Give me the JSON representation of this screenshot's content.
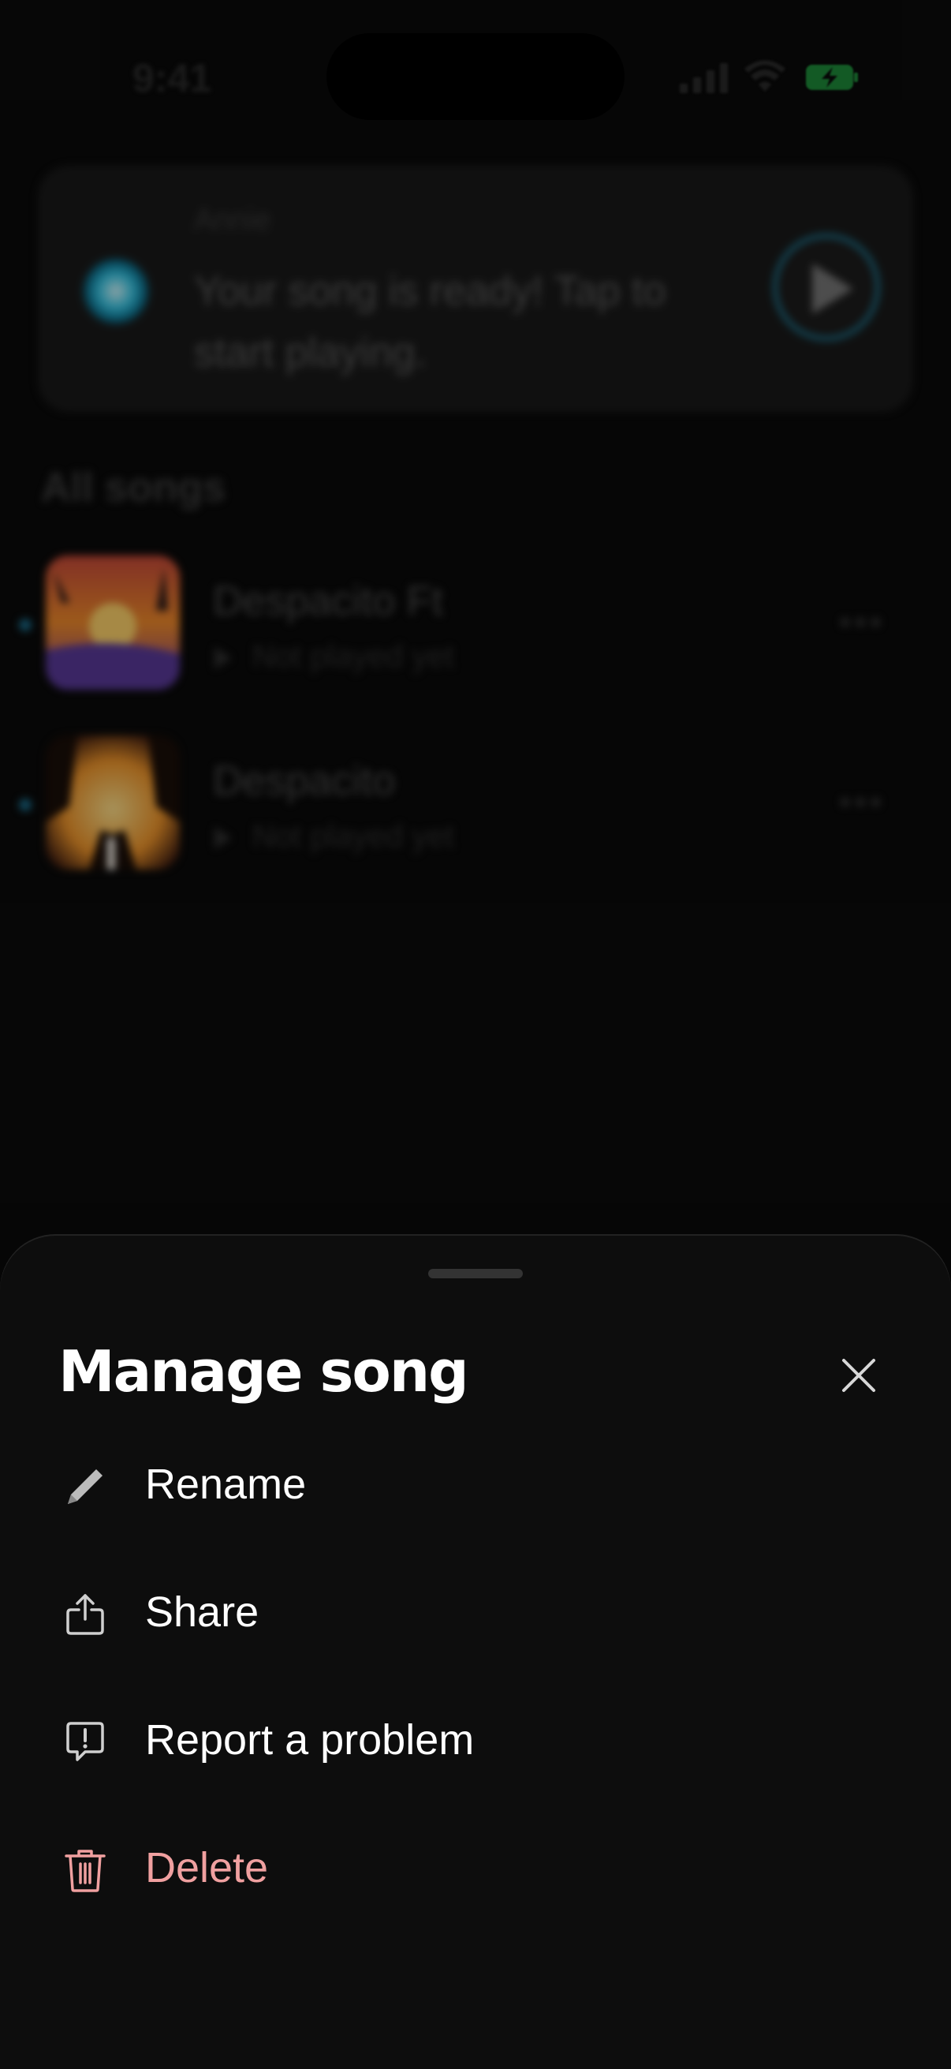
{
  "status_bar": {
    "time": "9:41"
  },
  "notification": {
    "sender": "Annie",
    "message": "Your song is ready! Tap to start playing."
  },
  "songs_section": {
    "title": "All songs",
    "songs": [
      {
        "title": "Despacito Ft",
        "status": "Not played yet",
        "more": "•••"
      },
      {
        "title": "Despacito",
        "status": "Not played yet",
        "more": "•••"
      }
    ]
  },
  "sheet": {
    "title": "Manage song",
    "items": [
      {
        "label": "Rename",
        "icon": "pencil-icon"
      },
      {
        "label": "Share",
        "icon": "share-icon"
      },
      {
        "label": "Report a problem",
        "icon": "report-icon"
      },
      {
        "label": "Delete",
        "icon": "trash-icon"
      }
    ]
  },
  "colors": {
    "sheet_background": "#0d0d0d",
    "delete_color": "#f0a0a0",
    "battery_green": "#34c759"
  }
}
